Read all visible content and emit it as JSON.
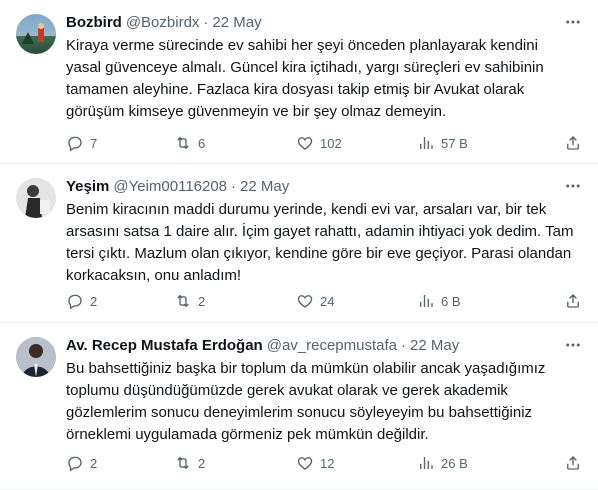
{
  "tweets": [
    {
      "name": "Bozbird",
      "handle": "@Bozbirdx",
      "date": "22 May",
      "text": "Kiraya verme sürecinde ev sahibi her şeyi önceden planlayarak kendini yasal güvenceye almalı. Güncel kira içtihadı, yargı süreçleri ev sahibinin tamamen aleyhine. Fazlaca kira dosyası takip etmiş bir Avukat olarak görüşüm kimseye güvenmeyin ve bir şey olmaz demeyin.",
      "replies": "7",
      "reposts": "6",
      "likes": "102",
      "views": "57 B"
    },
    {
      "name": "Yeşim",
      "handle": "@Yeim00116208",
      "date": "22 May",
      "text": "Benim kiracının maddi durumu yerinde, kendi evi var, arsaları var, bir tek arsasını satsa 1 daire alır. İçim gayet rahattı, adamin ihtiyaci yok dedim. Tam tersi çıktı. Mazlum olan çıkıyor, kendine göre bir eve geçiyor. Parasi olandan korkacaksın, onu anladım!",
      "replies": "2",
      "reposts": "2",
      "likes": "24",
      "views": "6 B"
    },
    {
      "name": "Av. Recep Mustafa Erdoğan",
      "handle": "@av_recepmustafa",
      "date": "22 May",
      "text": "Bu bahsettiğiniz başka bir toplum da mümkün olabilir ancak yaşadığımız toplumu düşündüğümüzde gerek avukat olarak ve gerek akademik gözlemlerim sonucu deneyimlerim sonucu söyleyeyim bu bahsettiğiniz örneklemi uygulamada görmeniz pek mümkün değildir.",
      "replies": "2",
      "reposts": "2",
      "likes": "12",
      "views": "26 B"
    }
  ],
  "separator": "·",
  "icons": {
    "reply": "reply-icon",
    "repost": "repost-icon",
    "like": "like-icon",
    "views": "views-icon",
    "share": "share-icon",
    "more": "more-icon"
  },
  "colors": {
    "text": "#0f1419",
    "muted": "#536471",
    "border": "#eff3f4"
  }
}
